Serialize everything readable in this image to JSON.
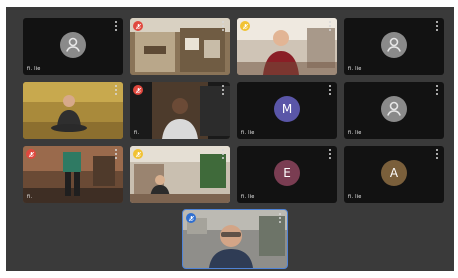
{
  "meeting": {
    "tiles": [
      {
        "id": "r1c1",
        "name": "fi. lie",
        "kind": "avatar",
        "initial": "",
        "avatar_color": "#8a8a8a",
        "mic": "none"
      },
      {
        "id": "r1c2",
        "name": "",
        "kind": "video",
        "mic": "red"
      },
      {
        "id": "r1c3",
        "name": "",
        "kind": "video",
        "mic": "yellow"
      },
      {
        "id": "r1c4",
        "name": "fi. lie",
        "kind": "avatar",
        "initial": "",
        "avatar_color": "#8a8a8a",
        "mic": "none"
      },
      {
        "id": "r2c1",
        "name": "",
        "kind": "video",
        "mic": "none"
      },
      {
        "id": "r2c2",
        "name": "fi.",
        "kind": "video",
        "mic": "red"
      },
      {
        "id": "r2c3",
        "name": "fi. lie",
        "kind": "avatar",
        "initial": "M",
        "avatar_color": "#5a56a8",
        "mic": "none"
      },
      {
        "id": "r2c4",
        "name": "fi. lie",
        "kind": "avatar",
        "initial": "",
        "avatar_color": "#8a8a8a",
        "mic": "none"
      },
      {
        "id": "r3c1",
        "name": "fi.",
        "kind": "video",
        "mic": "red"
      },
      {
        "id": "r3c2",
        "name": "",
        "kind": "video",
        "mic": "yellow"
      },
      {
        "id": "r3c3",
        "name": "fi. lie",
        "kind": "avatar",
        "initial": "E",
        "avatar_color": "#7a3d52",
        "mic": "none"
      },
      {
        "id": "r3c4",
        "name": "fi. lie",
        "kind": "avatar",
        "initial": "A",
        "avatar_color": "#7a5f3b",
        "mic": "none"
      },
      {
        "id": "self",
        "name": "",
        "kind": "video",
        "mic": "blue"
      }
    ]
  }
}
